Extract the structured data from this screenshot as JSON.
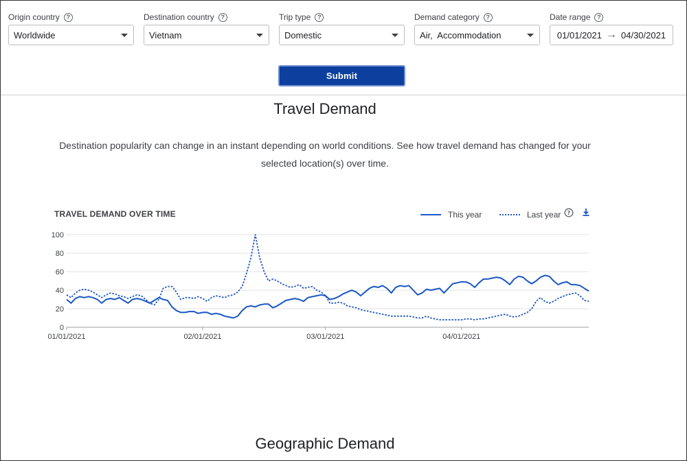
{
  "filters": {
    "origin": {
      "label": "Origin country",
      "value": "Worldwide"
    },
    "destination": {
      "label": "Destination country",
      "value": "Vietnam"
    },
    "trip_type": {
      "label": "Trip type",
      "value": "Domestic"
    },
    "demand_category": {
      "label": "Demand category",
      "value": "Air,  Accommodation"
    },
    "date_range": {
      "label": "Date range",
      "start": "01/01/2021",
      "end": "04/30/2021"
    }
  },
  "submit_label": "Submit",
  "travel_demand": {
    "title": "Travel Demand",
    "description": "Destination popularity can change in an instant depending on world conditions. See how travel demand has changed for your selected location(s) over time."
  },
  "chart_data": {
    "type": "line",
    "title": "TRAVEL DEMAND OVER TIME",
    "ylim": [
      0,
      100
    ],
    "yticks": [
      "100",
      "80",
      "60",
      "40",
      "20",
      "0"
    ],
    "ytick_values": [
      100,
      80,
      60,
      40,
      20,
      0
    ],
    "xticks": [
      "01/01/2021",
      "02/01/2021",
      "03/01/2021",
      "04/01/2021"
    ],
    "xtick_days": [
      0,
      31,
      59,
      90
    ],
    "x_range_days": [
      0,
      119
    ],
    "grid": true,
    "legend_position": "top-right",
    "series": [
      {
        "name": "This year",
        "style": "solid",
        "color": "#1a56c4",
        "points": [
          [
            0,
            30
          ],
          [
            1,
            26
          ],
          [
            2,
            31
          ],
          [
            3,
            33
          ],
          [
            4,
            32
          ],
          [
            5,
            33
          ],
          [
            6,
            32
          ],
          [
            7,
            30
          ],
          [
            8,
            26
          ],
          [
            9,
            30
          ],
          [
            10,
            31
          ],
          [
            11,
            30
          ],
          [
            12,
            32
          ],
          [
            13,
            29
          ],
          [
            14,
            26
          ],
          [
            15,
            30
          ],
          [
            16,
            31
          ],
          [
            17,
            30
          ],
          [
            18,
            28
          ],
          [
            19,
            26
          ],
          [
            20,
            29
          ],
          [
            21,
            32
          ],
          [
            22,
            30
          ],
          [
            23,
            29
          ],
          [
            24,
            22
          ],
          [
            25,
            18
          ],
          [
            26,
            16
          ],
          [
            27,
            16
          ],
          [
            28,
            17
          ],
          [
            29,
            17
          ],
          [
            30,
            15
          ],
          [
            31,
            16
          ],
          [
            32,
            16
          ],
          [
            33,
            14
          ],
          [
            34,
            15
          ],
          [
            35,
            14
          ],
          [
            36,
            12
          ],
          [
            37,
            11
          ],
          [
            38,
            10
          ],
          [
            39,
            12
          ],
          [
            40,
            18
          ],
          [
            41,
            22
          ],
          [
            42,
            23
          ],
          [
            43,
            22
          ],
          [
            44,
            24
          ],
          [
            45,
            25
          ],
          [
            46,
            25
          ],
          [
            47,
            21
          ],
          [
            48,
            23
          ],
          [
            49,
            26
          ],
          [
            50,
            29
          ],
          [
            51,
            30
          ],
          [
            52,
            31
          ],
          [
            53,
            30
          ],
          [
            54,
            28
          ],
          [
            55,
            32
          ],
          [
            56,
            33
          ],
          [
            57,
            34
          ],
          [
            58,
            35
          ],
          [
            59,
            34
          ],
          [
            60,
            30
          ],
          [
            61,
            31
          ],
          [
            62,
            33
          ],
          [
            63,
            36
          ],
          [
            64,
            38
          ],
          [
            65,
            40
          ],
          [
            66,
            38
          ],
          [
            67,
            34
          ],
          [
            68,
            38
          ],
          [
            69,
            42
          ],
          [
            70,
            44
          ],
          [
            71,
            43
          ],
          [
            72,
            45
          ],
          [
            73,
            42
          ],
          [
            74,
            37
          ],
          [
            75,
            43
          ],
          [
            76,
            45
          ],
          [
            77,
            44
          ],
          [
            78,
            45
          ],
          [
            79,
            40
          ],
          [
            80,
            35
          ],
          [
            81,
            37
          ],
          [
            82,
            41
          ],
          [
            83,
            40
          ],
          [
            84,
            41
          ],
          [
            85,
            42
          ],
          [
            86,
            37
          ],
          [
            87,
            42
          ],
          [
            88,
            47
          ],
          [
            89,
            48
          ],
          [
            90,
            49
          ],
          [
            91,
            49
          ],
          [
            92,
            47
          ],
          [
            93,
            43
          ],
          [
            94,
            48
          ],
          [
            95,
            52
          ],
          [
            96,
            52
          ],
          [
            97,
            53
          ],
          [
            98,
            54
          ],
          [
            99,
            53
          ],
          [
            100,
            50
          ],
          [
            101,
            46
          ],
          [
            102,
            52
          ],
          [
            103,
            55
          ],
          [
            104,
            54
          ],
          [
            105,
            50
          ],
          [
            106,
            47
          ],
          [
            107,
            50
          ],
          [
            108,
            54
          ],
          [
            109,
            56
          ],
          [
            110,
            55
          ],
          [
            111,
            50
          ],
          [
            112,
            46
          ],
          [
            113,
            48
          ],
          [
            114,
            49
          ],
          [
            115,
            46
          ],
          [
            116,
            46
          ],
          [
            117,
            45
          ],
          [
            118,
            42
          ],
          [
            119,
            39
          ]
        ]
      },
      {
        "name": "Last year",
        "style": "dotted",
        "color": "#1a56c4",
        "points": [
          [
            0,
            35
          ],
          [
            1,
            32
          ],
          [
            2,
            37
          ],
          [
            3,
            40
          ],
          [
            4,
            41
          ],
          [
            5,
            40
          ],
          [
            6,
            38
          ],
          [
            7,
            35
          ],
          [
            8,
            32
          ],
          [
            9,
            35
          ],
          [
            10,
            37
          ],
          [
            11,
            36
          ],
          [
            12,
            34
          ],
          [
            13,
            33
          ],
          [
            14,
            31
          ],
          [
            15,
            33
          ],
          [
            16,
            35
          ],
          [
            17,
            34
          ],
          [
            18,
            30
          ],
          [
            19,
            26
          ],
          [
            20,
            24
          ],
          [
            21,
            30
          ],
          [
            22,
            42
          ],
          [
            23,
            44
          ],
          [
            24,
            44
          ],
          [
            25,
            38
          ],
          [
            26,
            30
          ],
          [
            27,
            32
          ],
          [
            28,
            32
          ],
          [
            29,
            31
          ],
          [
            30,
            33
          ],
          [
            31,
            31
          ],
          [
            32,
            28
          ],
          [
            33,
            32
          ],
          [
            34,
            34
          ],
          [
            35,
            33
          ],
          [
            36,
            32
          ],
          [
            37,
            34
          ],
          [
            38,
            35
          ],
          [
            39,
            38
          ],
          [
            40,
            44
          ],
          [
            41,
            58
          ],
          [
            42,
            75
          ],
          [
            43,
            100
          ],
          [
            44,
            75
          ],
          [
            45,
            60
          ],
          [
            46,
            50
          ],
          [
            47,
            52
          ],
          [
            48,
            50
          ],
          [
            49,
            47
          ],
          [
            50,
            45
          ],
          [
            51,
            43
          ],
          [
            52,
            44
          ],
          [
            53,
            46
          ],
          [
            54,
            42
          ],
          [
            55,
            43
          ],
          [
            56,
            44
          ],
          [
            57,
            40
          ],
          [
            58,
            38
          ],
          [
            59,
            34
          ],
          [
            60,
            26
          ],
          [
            61,
            26
          ],
          [
            62,
            27
          ],
          [
            63,
            26
          ],
          [
            64,
            23
          ],
          [
            65,
            22
          ],
          [
            66,
            21
          ],
          [
            67,
            19
          ],
          [
            68,
            18
          ],
          [
            69,
            17
          ],
          [
            70,
            16
          ],
          [
            71,
            15
          ],
          [
            72,
            14
          ],
          [
            73,
            13
          ],
          [
            74,
            12
          ],
          [
            75,
            12
          ],
          [
            76,
            12
          ],
          [
            77,
            12
          ],
          [
            78,
            12
          ],
          [
            79,
            11
          ],
          [
            80,
            10
          ],
          [
            81,
            10
          ],
          [
            82,
            12
          ],
          [
            83,
            10
          ],
          [
            84,
            9
          ],
          [
            85,
            8
          ],
          [
            86,
            8
          ],
          [
            87,
            8
          ],
          [
            88,
            8
          ],
          [
            89,
            8
          ],
          [
            90,
            8
          ],
          [
            91,
            9
          ],
          [
            92,
            9
          ],
          [
            93,
            8
          ],
          [
            94,
            9
          ],
          [
            95,
            9
          ],
          [
            96,
            10
          ],
          [
            97,
            11
          ],
          [
            98,
            12
          ],
          [
            99,
            13
          ],
          [
            100,
            14
          ],
          [
            101,
            12
          ],
          [
            102,
            11
          ],
          [
            103,
            12
          ],
          [
            104,
            14
          ],
          [
            105,
            16
          ],
          [
            106,
            20
          ],
          [
            107,
            28
          ],
          [
            108,
            32
          ],
          [
            109,
            28
          ],
          [
            110,
            26
          ],
          [
            111,
            28
          ],
          [
            112,
            31
          ],
          [
            113,
            33
          ],
          [
            114,
            35
          ],
          [
            115,
            36
          ],
          [
            116,
            37
          ],
          [
            117,
            34
          ],
          [
            118,
            29
          ],
          [
            119,
            28
          ]
        ]
      }
    ]
  },
  "geographic_demand": {
    "title": "Geographic Demand"
  },
  "icons": {
    "help": "help-circle-icon",
    "download": "download-icon",
    "dropdown": "chevron-down-icon",
    "date_arrow": "arrow-right-icon"
  },
  "colors": {
    "primary": "#0d3f9e",
    "series": "#1a56c4",
    "grid": "#e0e0e0"
  }
}
